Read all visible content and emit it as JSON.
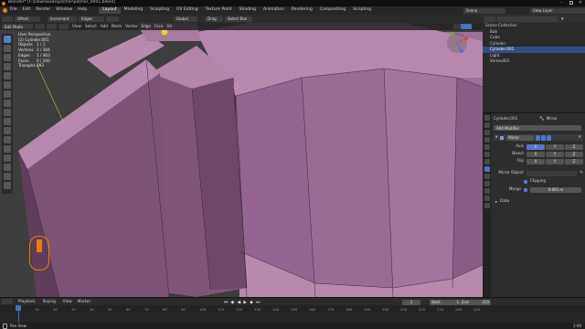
{
  "window": {
    "title": "Blender* [F:\\Downloads\\pitcher\\pitcher_0001.blend]"
  },
  "menu": {
    "items": [
      "File",
      "Edit",
      "Render",
      "Window",
      "Help"
    ]
  },
  "workspaces": {
    "tabs": [
      "Layout",
      "Modeling",
      "Sculpting",
      "UV Editing",
      "Texture Paint",
      "Shading",
      "Animation",
      "Rendering",
      "Compositing",
      "Scripting"
    ],
    "active": "Layout"
  },
  "top_right": {
    "scene": "Scene",
    "view_layer": "View Layer"
  },
  "toolrow": {
    "transform_pivot": "Offset",
    "snap": "Increment",
    "mesh_select": "Edges",
    "proportional": "Global",
    "drag": "Drag",
    "select_box": "Select Box"
  },
  "viewport_header": {
    "mode": "Edit Mode",
    "menus": [
      "View",
      "Select",
      "Add",
      "Mesh",
      "Vertex",
      "Edge",
      "Face",
      "UV"
    ]
  },
  "viewport_overlay": {
    "view": "User Perspective",
    "object": "(2) Cylinder.001",
    "stats": [
      {
        "label": "Objects",
        "value": "1 / 1"
      },
      {
        "label": "Vertices",
        "value": "2 / 304"
      },
      {
        "label": "Edges",
        "value": "1 / 463"
      },
      {
        "label": "Faces",
        "value": "0 / 200"
      },
      {
        "label": "Triangles",
        "value": "392"
      }
    ]
  },
  "outliner": {
    "title": "Scene Collection",
    "items": [
      {
        "label": "Bob",
        "selected": false
      },
      {
        "label": "Cube",
        "selected": false
      },
      {
        "label": "Cylinder",
        "selected": false
      },
      {
        "label": "Cylinder.001",
        "selected": true
      },
      {
        "label": "Light",
        "selected": false
      },
      {
        "label": "Vertex001",
        "selected": false
      }
    ]
  },
  "properties": {
    "object": "Cylinder.001",
    "modifier_tab": "Mirror",
    "add_modifier": "Add Modifier",
    "modifier_name": "Mirror",
    "axis_label": "Axis",
    "bisect_label": "Bisect",
    "flip_label": "Flip",
    "axes": [
      "X",
      "Y",
      "Z"
    ],
    "mirror_object_label": "Mirror Object",
    "clipping_label": "Clipping",
    "merge_label": "Merge",
    "merge_value": "0.001 m",
    "data_label": "Data"
  },
  "timeline": {
    "menus": [
      "Playback",
      "Keying",
      "View",
      "Marker"
    ],
    "start_label": "Start",
    "start": "1",
    "end_label": "End",
    "end": "250",
    "current_frame": "1",
    "ticks": [
      "0",
      "10",
      "20",
      "30",
      "40",
      "50",
      "60",
      "70",
      "80",
      "90",
      "100",
      "110",
      "120",
      "130",
      "140",
      "150",
      "160",
      "170",
      "180",
      "190",
      "200",
      "210",
      "220",
      "230",
      "240",
      "250"
    ]
  },
  "status": {
    "left": "Pan View",
    "right": "2.90"
  },
  "colors": {
    "mesh": "#a7779f",
    "mesh_dark": "#6a4866",
    "select_blue": "#4a73b8",
    "accent_orange": "#e87d0d"
  }
}
